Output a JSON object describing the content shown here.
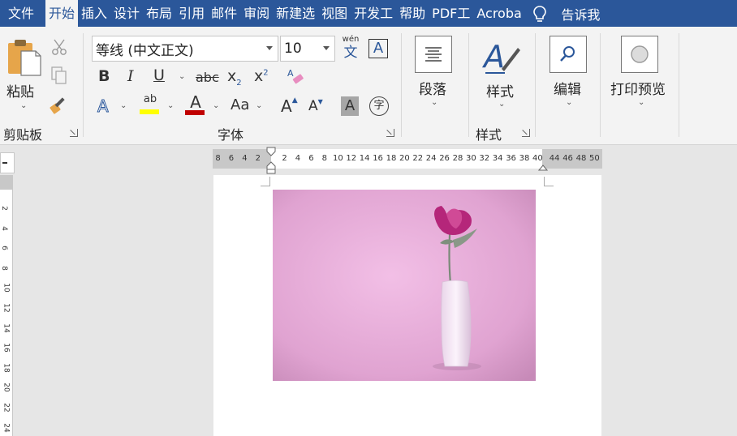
{
  "tabs": [
    {
      "label": "文件",
      "active": false
    },
    {
      "label": "开始",
      "active": true
    },
    {
      "label": "插入",
      "active": false
    },
    {
      "label": "设计",
      "active": false
    },
    {
      "label": "布局",
      "active": false
    },
    {
      "label": "引用",
      "active": false
    },
    {
      "label": "邮件",
      "active": false
    },
    {
      "label": "审阅",
      "active": false
    },
    {
      "label": "新建选",
      "active": false
    },
    {
      "label": "视图",
      "active": false
    },
    {
      "label": "开发工",
      "active": false
    },
    {
      "label": "帮助",
      "active": false
    },
    {
      "label": "PDF工",
      "active": false
    },
    {
      "label": "Acroba",
      "active": false
    }
  ],
  "tell_me": "告诉我",
  "clipboard": {
    "paste_label": "粘贴",
    "group_label": "剪贴板"
  },
  "font": {
    "font_name": "等线 (中文正文)",
    "font_size": "10",
    "phonetic_top": "wén",
    "phonetic_bottom": "文",
    "border_char": "A",
    "bold": "B",
    "italic": "I",
    "underline": "U",
    "strike": "abc",
    "subscript_base": "x",
    "subscript_mark": "2",
    "superscript_base": "x",
    "superscript_mark": "2",
    "text_effect": "A",
    "highlight": "ab",
    "font_color": "A",
    "change_case": "Aa",
    "grow": "A",
    "shrink": "A",
    "shade": "A",
    "enclose": "字",
    "group_label": "字体"
  },
  "paragraph": {
    "label": "段落"
  },
  "styles": {
    "label": "样式",
    "group_label": "样式"
  },
  "editing": {
    "label": "编辑"
  },
  "print_preview": {
    "label": "打印预览"
  },
  "ruler": {
    "left_marks": [
      "8",
      "6",
      "4",
      "2"
    ],
    "marks": [
      "2",
      "4",
      "6",
      "8",
      "10",
      "12",
      "14",
      "16",
      "18",
      "20",
      "22",
      "24",
      "26",
      "28",
      "30",
      "32",
      "34",
      "36",
      "38",
      "40"
    ],
    "right_marks": [
      "44",
      "46",
      "48",
      "50"
    ],
    "vertical_marks": [
      "2",
      "4",
      "6",
      "8",
      "10",
      "12",
      "14",
      "16",
      "18",
      "20",
      "22",
      "24"
    ]
  },
  "colors": {
    "tab_bar": "#2b579a",
    "ribbon": "#f3f3f3",
    "highlight_yellow": "#ffff00",
    "font_red": "#c00000",
    "accent_blue": "#2b579a",
    "photo_bg": "#e8a9d8"
  },
  "icons": {
    "tell_me": "lightbulb-icon",
    "paste": "clipboard-icon",
    "cut": "scissors-icon",
    "copy": "copy-icon",
    "format_painter": "paintbrush-icon",
    "clear_format": "eraser-icon",
    "paragraph": "paragraph-lines-icon",
    "styles": "styles-pen-icon",
    "editing": "search-icon",
    "print_preview": "circle-icon"
  }
}
